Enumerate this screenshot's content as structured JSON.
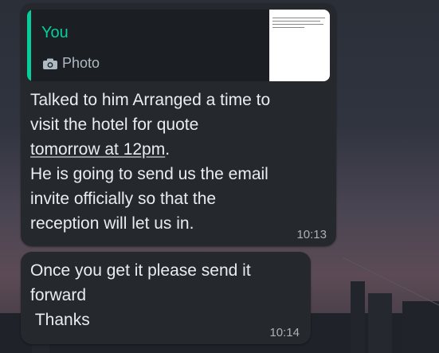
{
  "chat": {
    "reply_preview": {
      "author": "You",
      "type_label": "Photo",
      "icon": "camera-icon"
    },
    "messages": [
      {
        "line_1": "Talked to him Arranged a time to",
        "line_2": "visit the hotel for quote",
        "line_3": "tomorrow at 12pm",
        "line_3_suffix": ".",
        "line_4": "He is going to send us the email",
        "line_5": "invite officially so that the",
        "line_6": "reception will let us in.",
        "time": "10:13"
      },
      {
        "line_1": "Once you get it please send it",
        "line_2": "forward",
        "line_3": " Thanks",
        "time": "10:14"
      }
    ]
  },
  "colors": {
    "bubble": "#25292e",
    "accent": "#06cf9c",
    "text": "#e9edef",
    "timestamp": "#a9b2b8"
  }
}
